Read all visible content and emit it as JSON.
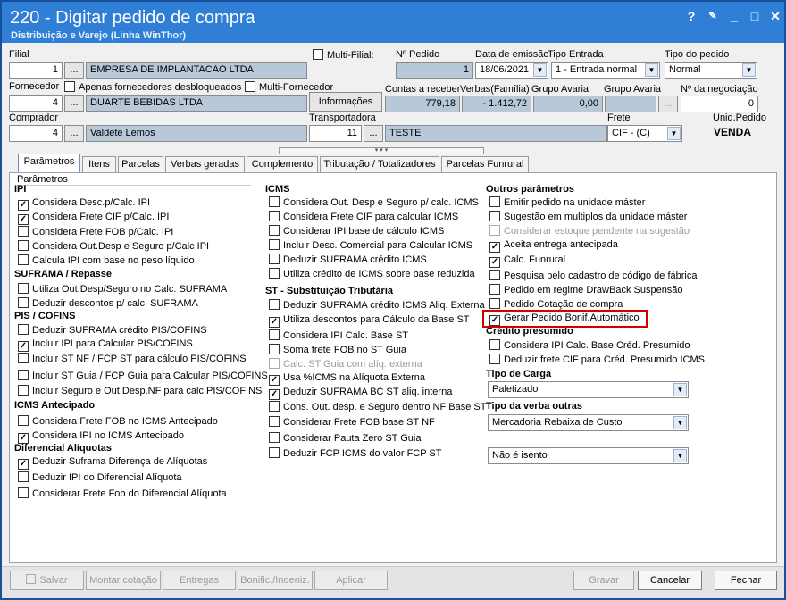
{
  "window": {
    "title": "220 - Digitar pedido de compra",
    "subtitle": "Distribuição e Varejo (Linha WinThor)",
    "help": "?",
    "restore": "□",
    "close": "✕"
  },
  "filial": {
    "label": "Filial",
    "code": "1",
    "name": "EMPRESA DE IMPLANTACAO LTDA",
    "multi": "Multi-Filial:"
  },
  "pedido": {
    "label": "Nº Pedido",
    "value": "1"
  },
  "data_emissao": {
    "label": "Data de emissão",
    "value": "18/06/2021"
  },
  "tipo_entrada": {
    "label": "Tipo Entrada",
    "value": "1 - Entrada normal"
  },
  "tipo_pedido": {
    "label": "Tipo do pedido",
    "value": "Normal"
  },
  "fornecedor": {
    "label": "Fornecedor",
    "code": "4",
    "name": "DUARTE BEBIDAS LTDA",
    "desb": "Apenas fornecedores desbloqueados",
    "multi": "Multi-Fornecedor",
    "info": "Informações"
  },
  "contas": {
    "label": "Contas a receber",
    "value": "779,18"
  },
  "verbas": {
    "label": "Verbas(Família)",
    "value": "- 1.412,72"
  },
  "grupo1": {
    "label": "Grupo Avaria",
    "value": "0,00"
  },
  "grupo2": {
    "label": "Grupo Avaria"
  },
  "negociacao": {
    "label": "Nº da negociação",
    "value": "0"
  },
  "comprador": {
    "label": "Comprador",
    "code": "4",
    "name": "Valdete Lemos"
  },
  "transp": {
    "label": "Transportadora",
    "code": "11",
    "name": "TESTE"
  },
  "frete": {
    "label": "Frete",
    "value": "CIF - (C)"
  },
  "unid": {
    "label": "Unid.Pedido",
    "value": "VENDA"
  },
  "dots": "...",
  "tabs": [
    "Parâmetros",
    "Itens",
    "Parcelas",
    "Verbas geradas",
    "Complemento",
    "Tributação / Totalizadores",
    "Parcelas Funrural"
  ],
  "panel_title": "Parâmetros",
  "col1": [
    {
      "t": "h",
      "label": "IPI"
    },
    {
      "t": "c",
      "label": "Considera Desc.p/Calc. IPI",
      "checked": true
    },
    {
      "t": "c",
      "label": "Considera Frete CIF p/Calc. IPI",
      "checked": true
    },
    {
      "t": "c",
      "label": "Considera Frete FOB p/Calc. IPI",
      "checked": false
    },
    {
      "t": "c",
      "label": "Considera Out.Desp e Seguro p/Calc IPI",
      "checked": false
    },
    {
      "t": "c",
      "label": "Calcula IPI com base no peso líquido",
      "checked": false
    },
    {
      "t": "h",
      "label": "SUFRAMA / Repasse"
    },
    {
      "t": "c",
      "label": "Utiliza Out.Desp/Seguro no Calc. SUFRAMA",
      "checked": false
    },
    {
      "t": "c",
      "label": "Deduzir descontos p/ calc. SUFRAMA",
      "checked": false
    },
    {
      "t": "h",
      "label": "PIS / COFINS"
    },
    {
      "t": "c",
      "label": "Deduzir SUFRAMA crédito PIS/COFINS",
      "checked": false
    },
    {
      "t": "c",
      "label": "Incluir IPI para Calcular PIS/COFINS",
      "checked": true
    },
    {
      "t": "c",
      "label": "Incluir ST NF / FCP ST para cálculo PIS/COFINS",
      "checked": false
    },
    {
      "t": "c",
      "label": "Incluir ST Guia / FCP Guia para Calcular PIS/COFINS",
      "checked": false
    },
    {
      "t": "c",
      "label": "Incluir Seguro e Out.Desp.NF para calc.PIS/COFINS",
      "checked": false
    },
    {
      "t": "h",
      "label": "ICMS Antecipado"
    },
    {
      "t": "c",
      "label": "Considera Frete FOB no ICMS Antecipado",
      "checked": false
    },
    {
      "t": "c",
      "label": "Considera IPI no ICMS Antecipado",
      "checked": true
    },
    {
      "t": "h",
      "label": "Diferencial Alíquotas"
    },
    {
      "t": "c",
      "label": "Deduzir Suframa Diferença de Alíquotas",
      "checked": true
    },
    {
      "t": "c",
      "label": "Deduzir IPI do Diferencial Alíquota",
      "checked": false
    },
    {
      "t": "c",
      "label": "Considerar Frete Fob do Diferencial Alíquota",
      "checked": false
    }
  ],
  "col2": [
    {
      "t": "h",
      "label": "ICMS"
    },
    {
      "t": "c",
      "label": "Considera Out. Desp e Seguro p/ calc. ICMS",
      "checked": false
    },
    {
      "t": "c",
      "label": "Considera Frete CIF para calcular ICMS",
      "checked": false
    },
    {
      "t": "c",
      "label": "Considerar IPI base de cálculo ICMS",
      "checked": false
    },
    {
      "t": "c",
      "label": "Incluir Desc. Comercial  para Calcular ICMS",
      "checked": false
    },
    {
      "t": "c",
      "label": "Deduzir SUFRAMA crédito ICMS",
      "checked": false
    },
    {
      "t": "c",
      "label": "Utiliza crédito de ICMS sobre base reduzida",
      "checked": false
    },
    {
      "t": "h",
      "label": "ST - Substituição Tributária"
    },
    {
      "t": "c",
      "label": "Deduzir SUFRAMA crédito ICMS Aliq. Externa",
      "checked": false
    },
    {
      "t": "c",
      "label": "Utiliza descontos para Cálculo da Base ST",
      "checked": true
    },
    {
      "t": "c",
      "label": "Considera IPI Calc. Base ST",
      "checked": false
    },
    {
      "t": "c",
      "label": "Soma frete FOB no ST Guia",
      "checked": false
    },
    {
      "t": "c",
      "label": "Calc. ST Guia com alíq. externa",
      "checked": false,
      "disabled": true
    },
    {
      "t": "c",
      "label": "Usa %ICMS na Alíquota Externa",
      "checked": true
    },
    {
      "t": "c",
      "label": "Deduzir SUFRAMA BC ST aliq. interna",
      "checked": true
    },
    {
      "t": "c",
      "label": "Cons. Out. desp. e Seguro dentro NF Base ST",
      "checked": false
    },
    {
      "t": "c",
      "label": "Considerar Frete FOB base ST NF",
      "checked": false
    },
    {
      "t": "c",
      "label": "Considerar Pauta Zero ST Guia",
      "checked": false
    },
    {
      "t": "c",
      "label": "Deduzir FCP ICMS do valor FCP ST",
      "checked": false
    }
  ],
  "col3": [
    {
      "t": "h",
      "label": "Outros parâmetros"
    },
    {
      "t": "c",
      "label": "Emitir pedido na unidade máster",
      "checked": false
    },
    {
      "t": "c",
      "label": "Sugestão em multiplos da unidade máster",
      "checked": false
    },
    {
      "t": "c",
      "label": "Considerar estoque pendente na sugestão",
      "checked": false,
      "disabled": true
    },
    {
      "t": "c",
      "label": "Aceita entrega antecipada",
      "checked": true
    },
    {
      "t": "c",
      "label": "Calc. Funrural",
      "checked": true
    },
    {
      "t": "c",
      "label": "Pesquisa pelo cadastro de código de fábrica",
      "checked": false
    },
    {
      "t": "c",
      "label": "Pedido em regime DrawBack Suspensão",
      "checked": false
    },
    {
      "t": "c",
      "label": "Pedido Cotação de compra",
      "checked": false
    },
    {
      "t": "c",
      "label": "Gerar Pedido Bonif.Automático",
      "checked": true
    },
    {
      "t": "h",
      "label": "Crédito presumido"
    },
    {
      "t": "c",
      "label": "Considera IPI Calc. Base Créd. Presumido",
      "checked": false
    },
    {
      "t": "c",
      "label": "Deduzir frete CIF para Créd. Presumido ICMS",
      "checked": false
    }
  ],
  "tipo_carga": {
    "label": "Tipo de Carga",
    "value": "Paletizado"
  },
  "tipo_verba": {
    "label": "Tipo da verba outras",
    "value": "Mercadoria Rebaixa de Custo"
  },
  "isento": {
    "value": "Não é isento"
  },
  "footer": {
    "salvar": "Salvar",
    "montar": "Montar cotação",
    "entregas": "Entregas",
    "bonific": "Bonific./Indeniz.",
    "aplicar": "Aplicar",
    "gravar": "Gravar",
    "cancelar": "Cancelar",
    "fechar": "Fechar"
  }
}
